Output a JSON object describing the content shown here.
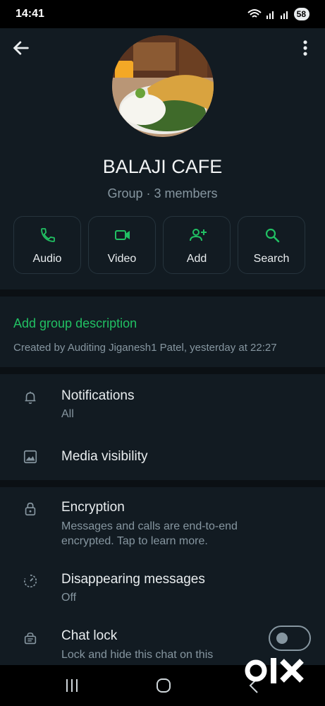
{
  "status_bar": {
    "time": "14:41",
    "battery": "58",
    "icons": [
      "wifi-icon",
      "signal-icon",
      "signal-icon",
      "battery-icon"
    ]
  },
  "header": {
    "back_icon": "arrow-left-icon",
    "menu_icon": "more-vert-icon",
    "group_name": "BALAJI CAFE",
    "subtitle": "Group · 3 members"
  },
  "actions": [
    {
      "label": "Audio",
      "icon": "phone-icon"
    },
    {
      "label": "Video",
      "icon": "video-icon"
    },
    {
      "label": "Add",
      "icon": "add-person-icon"
    },
    {
      "label": "Search",
      "icon": "search-icon"
    }
  ],
  "description": {
    "add_label": "Add group description",
    "created": "Created by Auditing Jiganesh1 Patel, yesterday at 22:27"
  },
  "settings": {
    "notifications": {
      "title": "Notifications",
      "value": "All"
    },
    "media": {
      "title": "Media visibility"
    },
    "encryption": {
      "title": "Encryption",
      "desc": "Messages and calls are end-to-end encrypted. Tap to learn more."
    },
    "disappearing": {
      "title": "Disappearing messages",
      "value": "Off"
    },
    "chat_lock": {
      "title": "Chat lock",
      "desc": "Lock and hide this chat on this",
      "enabled": false
    }
  },
  "watermark": "olx",
  "colors": {
    "accent": "#21c063",
    "background": "#121b22",
    "secondary_text": "#8696a0"
  }
}
